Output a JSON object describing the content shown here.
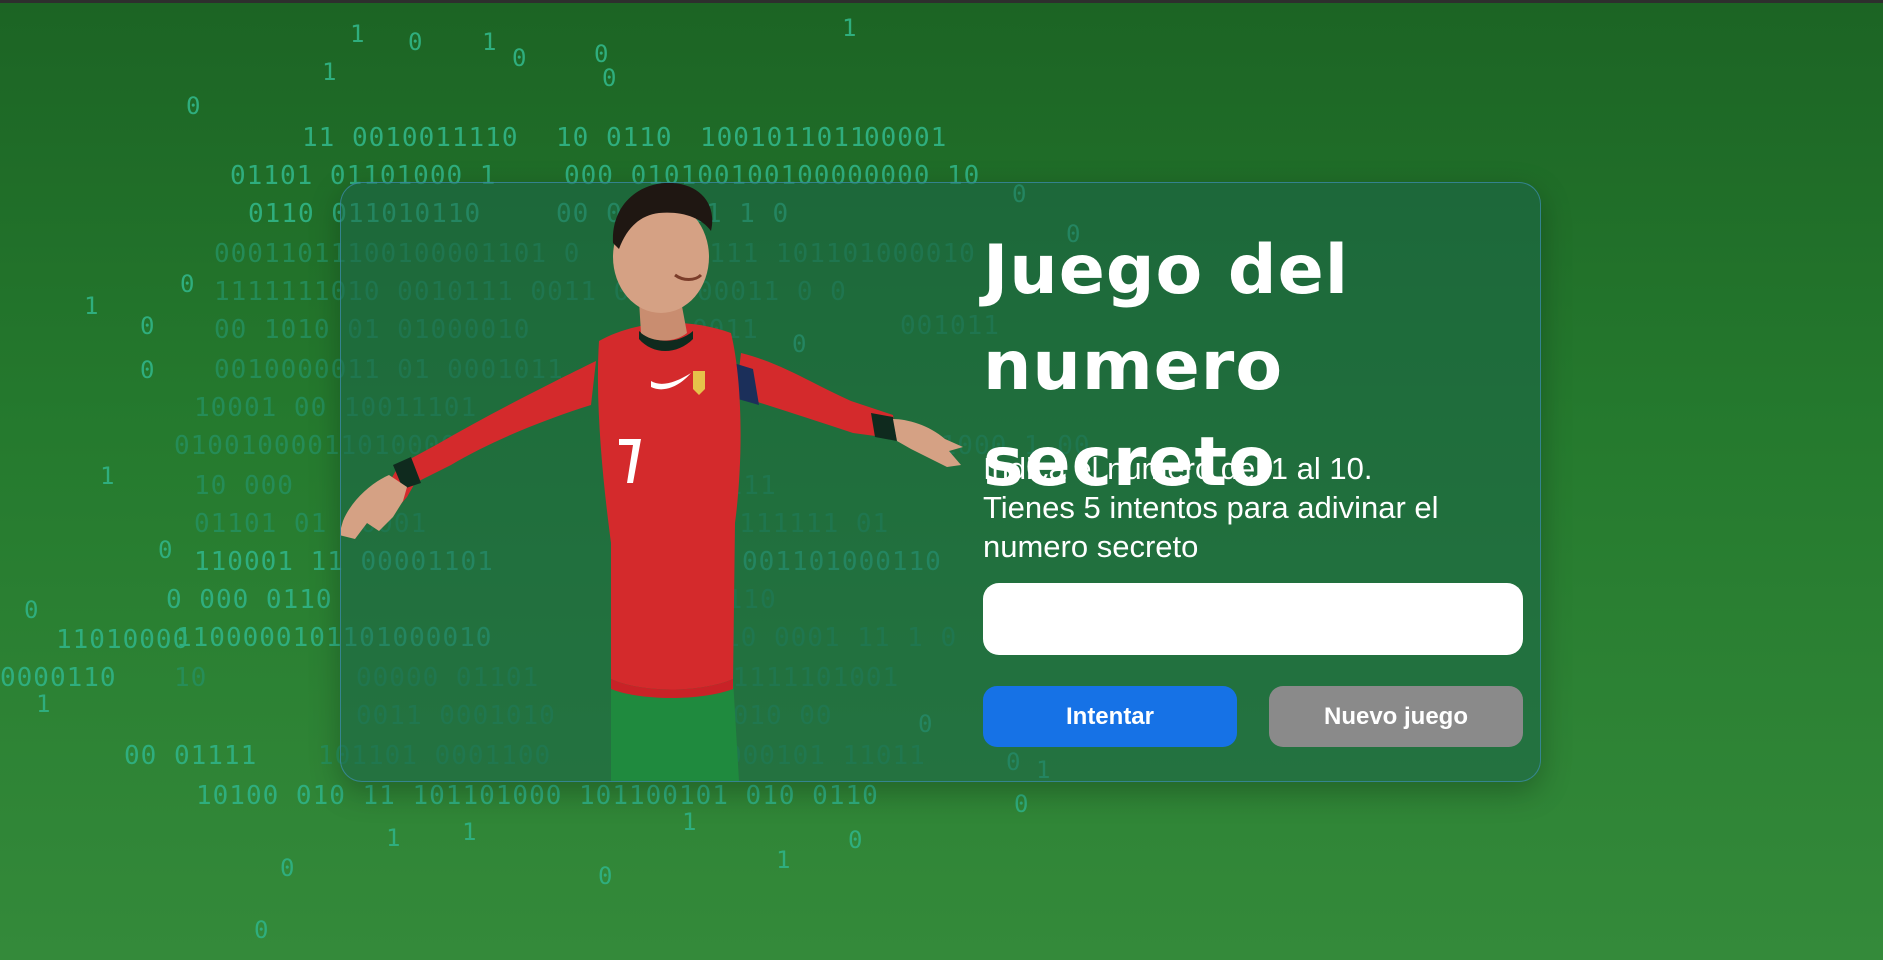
{
  "game": {
    "title_line1": "Juego del",
    "title_line2": "numero secreto",
    "instructions_line1": "Indica el numero del 1 al 10.",
    "instructions_line2": "Tienes 5 intentos para adivinar el",
    "instructions_line3": "numero secreto",
    "guess_value": "",
    "try_button": "Intentar",
    "new_game_button": "Nuevo juego"
  },
  "colors": {
    "background_top": "#1c6424",
    "background_bottom": "#348a3a",
    "binary_text": "#2fae7e",
    "try_button": "#1672e6",
    "new_game_button": "#8a8a8a"
  },
  "binary_rain": [
    "1",
    "0",
    "1",
    "0",
    "0",
    "1",
    "0",
    "1",
    "0",
    "11 0010011110",
    "10 0110",
    "1001011011",
    "00001",
    "01101 01101000 1",
    "000 010100100100000000 10",
    "0",
    "0110 011010110",
    "00 0011011 1 0",
    "0",
    "00011011100100001101 0",
    "01111 101101000010",
    "0",
    "1111111010 0010111 0011 0110000011 0 0",
    "1",
    "0",
    "00 1010 01 01000010",
    "0011",
    "001011",
    "0",
    "0010000011 01 0001011",
    "0",
    "10001 00 10011101",
    "01001000011010000",
    "01000 1 00",
    "1",
    "10 000",
    "0111",
    "01101 01 10001",
    "0 111111 01",
    "0",
    "110001 11 00001101",
    "001101000110",
    "0",
    "0 000 0110",
    "0110",
    "11010000",
    "1100000101101000010",
    "10 0001 11 1 0",
    "0000110",
    "10",
    "1",
    "00000 01101",
    "01111101001",
    "0011 0001010",
    "0010 00",
    "0",
    "00 01111",
    "101101 0001100",
    "000101 11011",
    "0",
    "1",
    "10100 010 11 101101000 101100101 010 0110",
    "0",
    "1",
    "1",
    "1",
    "0",
    "1",
    "0",
    "0",
    "0"
  ]
}
